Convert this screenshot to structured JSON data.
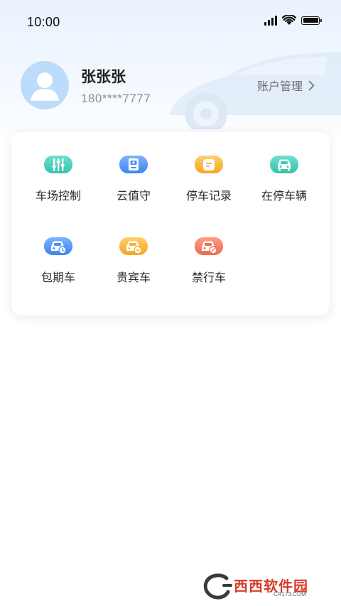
{
  "status_bar": {
    "time": "10:00",
    "icons": [
      "signal-icon",
      "wifi-icon",
      "battery-icon"
    ]
  },
  "profile": {
    "name": "张张张",
    "phone": "180****7777",
    "account_label": "账户管理"
  },
  "menu": [
    {
      "label": "车场控制",
      "icon": "sliders-icon",
      "color": "#3fcdb8"
    },
    {
      "label": "云值守",
      "icon": "cloud-guard-icon",
      "color": "#4a8ff5"
    },
    {
      "label": "停车记录",
      "icon": "record-icon",
      "color": "#f7b23c"
    },
    {
      "label": "在停车辆",
      "icon": "car-icon",
      "color": "#3cc8b4"
    },
    {
      "label": "包期车",
      "icon": "car-clock-icon",
      "color": "#4a8ff5"
    },
    {
      "label": "贵宾车",
      "icon": "car-vip-icon",
      "color": "#f7b23c"
    },
    {
      "label": "禁行车",
      "icon": "car-forbidden-icon",
      "color": "#f2725a"
    }
  ],
  "watermark": {
    "text": "西西软件园",
    "sub": "CR173.COM"
  }
}
